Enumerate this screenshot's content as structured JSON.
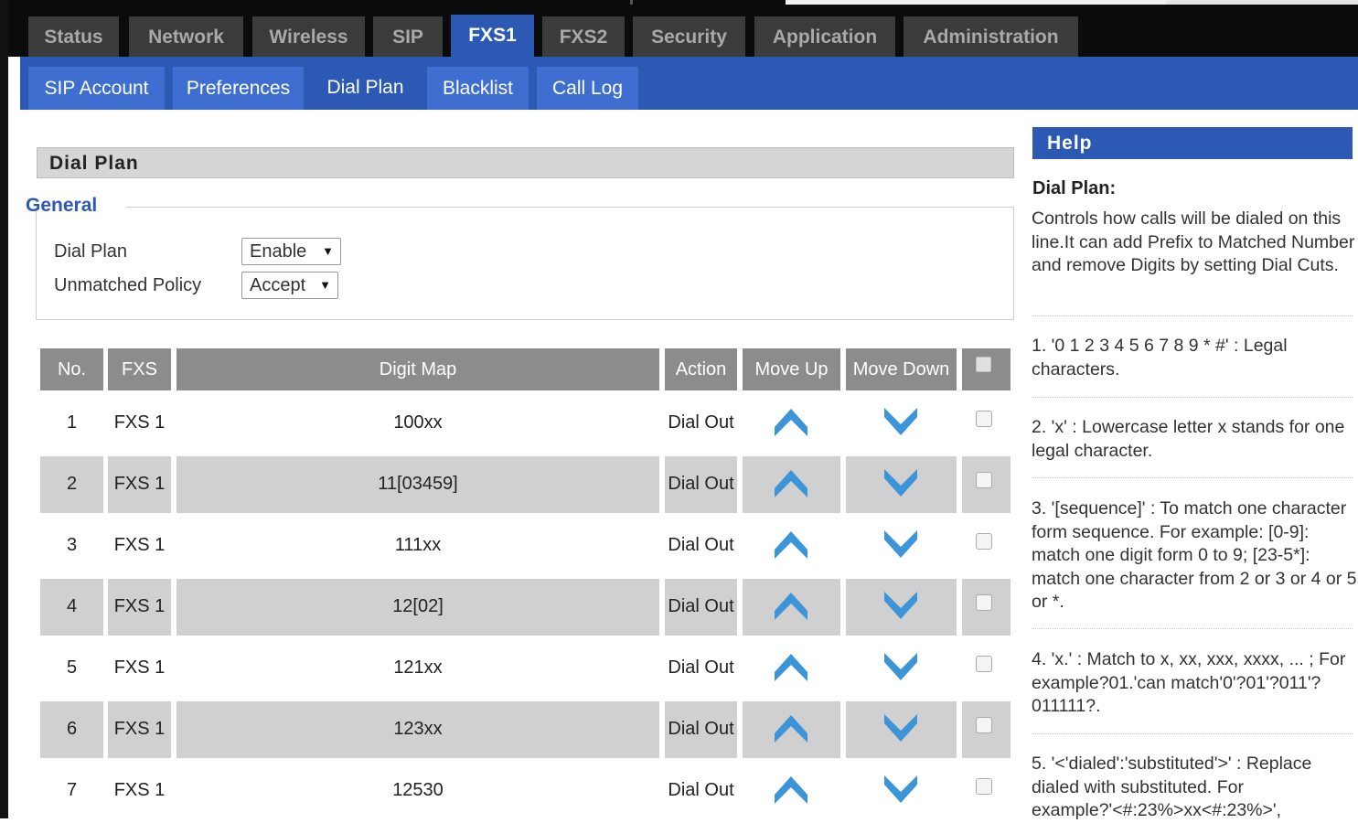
{
  "main_tabs": [
    {
      "label": "Status",
      "active": false
    },
    {
      "label": "Network",
      "active": false
    },
    {
      "label": "Wireless",
      "active": false
    },
    {
      "label": "SIP",
      "active": false
    },
    {
      "label": "FXS1",
      "active": true
    },
    {
      "label": "FXS2",
      "active": false
    },
    {
      "label": "Security",
      "active": false
    },
    {
      "label": "Application",
      "active": false
    },
    {
      "label": "Administration",
      "active": false
    }
  ],
  "sub_tabs": [
    {
      "label": "SIP Account",
      "active": false
    },
    {
      "label": "Preferences",
      "active": false
    },
    {
      "label": "Dial Plan",
      "active": true
    },
    {
      "label": "Blacklist",
      "active": false
    },
    {
      "label": "Call Log",
      "active": false
    }
  ],
  "section_title": "Dial Plan",
  "general": {
    "legend": "General",
    "dial_plan_label": "Dial Plan",
    "dial_plan_value": "Enable",
    "unmatched_label": "Unmatched Policy",
    "unmatched_value": "Accept"
  },
  "table": {
    "headers": {
      "no": "No.",
      "fxs": "FXS",
      "digit_map": "Digit Map",
      "action": "Action",
      "move_up": "Move Up",
      "move_down": "Move Down"
    },
    "rows": [
      {
        "no": "1",
        "fxs": "FXS 1",
        "digit_map": "100xx",
        "action": "Dial Out"
      },
      {
        "no": "2",
        "fxs": "FXS 1",
        "digit_map": "11[03459]",
        "action": "Dial Out"
      },
      {
        "no": "3",
        "fxs": "FXS 1",
        "digit_map": "111xx",
        "action": "Dial Out"
      },
      {
        "no": "4",
        "fxs": "FXS 1",
        "digit_map": "12[02]",
        "action": "Dial Out"
      },
      {
        "no": "5",
        "fxs": "FXS 1",
        "digit_map": "121xx",
        "action": "Dial Out"
      },
      {
        "no": "6",
        "fxs": "FXS 1",
        "digit_map": "123xx",
        "action": "Dial Out"
      },
      {
        "no": "7",
        "fxs": "FXS 1",
        "digit_map": "12530",
        "action": "Dial Out"
      }
    ]
  },
  "help": {
    "header": "Help",
    "title": "Dial Plan:",
    "intro": "Controls how calls will be dialed on this line.It can add Prefix to Matched Number and remove Digits by setting Dial Cuts.",
    "items": [
      "1. '0 1 2 3 4 5 6 7 8 9 * #' : Legal characters.",
      "2. 'x' : Lowercase letter x stands for one legal character.",
      "3. '[sequence]' : To match one character form sequence. For example: [0-9]: match one digit form 0 to 9; [23-5*]: match one character from 2 or 3 or 4 or 5 or *.",
      "4. 'x.' : Match to x, xx, xxx, xxxx, ... ; For example?01.'can match'0'?01'?011'?011111?.",
      "5. '<'dialed':'substituted'>' : Replace dialed with substituted. For example?'<#:23%>xx<#:23%>',"
    ]
  },
  "colors": {
    "accent": "#2b59b3",
    "subtab": "#3e6fd0",
    "icon": "#3b95d8",
    "header_gray": "#8c8c8c"
  }
}
